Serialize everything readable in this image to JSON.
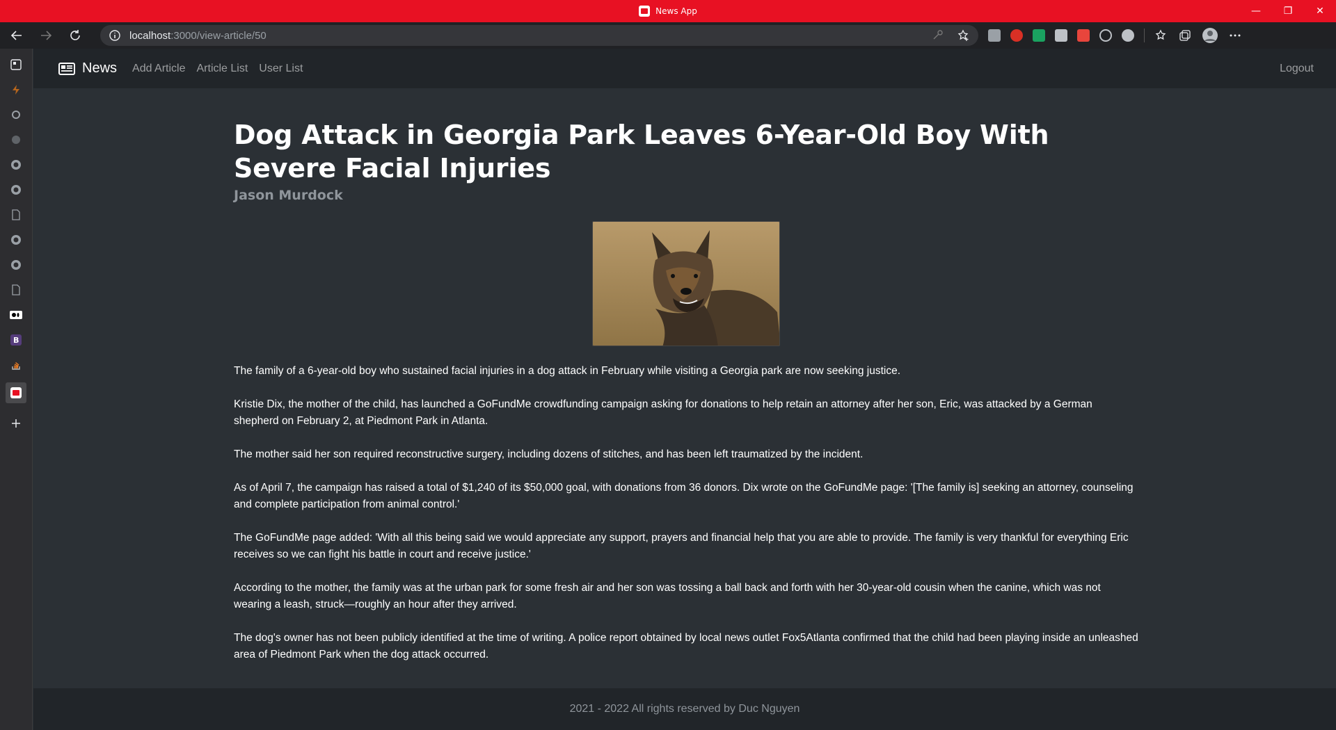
{
  "window": {
    "title": "News App"
  },
  "browser": {
    "url_host": "localhost",
    "url_rest": ":3000/view-article/50"
  },
  "navbar": {
    "brand": "News",
    "links": [
      "Add Article",
      "Article List",
      "User List"
    ],
    "logout": "Logout"
  },
  "article": {
    "title": "Dog Attack in Georgia Park Leaves 6-Year-Old Boy With Severe Facial Injuries",
    "author": "Jason Murdock",
    "image_alt": "german-shepherd",
    "paragraphs": [
      "The family of a 6-year-old boy who sustained facial injuries in a dog attack in February while visiting a Georgia park are now seeking justice.",
      "Kristie Dix, the mother of the child, has launched a GoFundMe crowdfunding campaign asking for donations to help retain an attorney after her son, Eric, was attacked by a German shepherd on February 2, at Piedmont Park in Atlanta.",
      "The mother said her son required reconstructive surgery, including dozens of stitches, and has been left traumatized by the incident.",
      "As of April 7, the campaign has raised a total of $1,240 of its $50,000 goal, with donations from 36 donors. Dix wrote on the GoFundMe page: '[The family is] seeking an attorney, counseling and complete participation from animal control.'",
      "The GoFundMe page added: 'With all this being said we would appreciate any support, prayers and financial help that you are able to provide. The family is very thankful for everything Eric receives so we can fight his battle in court and receive justice.'",
      "According to the mother, the family was at the urban park for some fresh air and her son was tossing a ball back and forth with her 30-year-old cousin when the canine, which was not wearing a leash, struck—roughly an hour after they arrived.",
      "The dog's owner has not been publicly identified at the time of writing. A police report obtained by local news outlet Fox5Atlanta confirmed that the child had been playing inside an unleashed area of Piedmont Park when the dog attack occurred."
    ]
  },
  "footer": {
    "text": "2021 - 2022 All rights reserved by Duc Nguyen"
  },
  "colors": {
    "titlebar": "#e81123",
    "navbar": "#212529",
    "page_bg": "#2b3035"
  }
}
